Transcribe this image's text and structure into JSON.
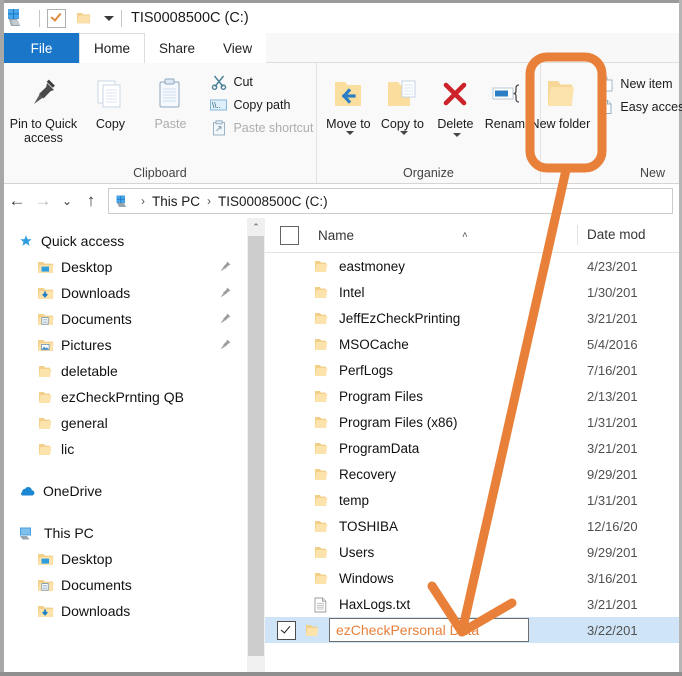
{
  "window": {
    "title": "TIS0008500C (C:)",
    "quick_access_icons": [
      "drive-icon",
      "properties-check-icon",
      "new-folder-icon",
      "customize-caret-icon"
    ]
  },
  "ribbon": {
    "tabs": [
      {
        "label": "File",
        "state": "file"
      },
      {
        "label": "Home",
        "state": "active"
      },
      {
        "label": "Share",
        "state": "normal"
      },
      {
        "label": "View",
        "state": "normal"
      }
    ],
    "groups": [
      {
        "name": "Clipboard",
        "label": "Clipboard",
        "big_buttons": [
          {
            "label": "Pin to Quick access",
            "icon": "pin-icon",
            "disabled": false
          },
          {
            "label": "Copy",
            "icon": "copy-icon",
            "disabled": false
          },
          {
            "label": "Paste",
            "icon": "paste-icon",
            "disabled": true
          }
        ],
        "small_buttons": [
          {
            "label": "Cut",
            "icon": "scissors-icon",
            "disabled": false
          },
          {
            "label": "Copy path",
            "icon": "copy-path-icon",
            "disabled": false
          },
          {
            "label": "Paste shortcut",
            "icon": "paste-shortcut-icon",
            "disabled": true
          }
        ]
      },
      {
        "name": "Organize",
        "label": "Organize",
        "big_buttons": [
          {
            "label": "Move to",
            "icon": "move-to-icon",
            "has_caret": true
          },
          {
            "label": "Copy to",
            "icon": "copy-to-icon",
            "has_caret": true
          },
          {
            "label": "Delete",
            "icon": "delete-x-icon",
            "has_caret": true
          },
          {
            "label": "Rename",
            "icon": "rename-icon",
            "has_caret": false
          }
        ]
      },
      {
        "name": "New",
        "label": "New",
        "big_buttons": [
          {
            "label": "New folder",
            "icon": "new-folder-icon",
            "highlighted": true
          }
        ],
        "small_buttons": [
          {
            "label": "New item",
            "icon": "new-item-icon",
            "has_caret": true
          },
          {
            "label": "Easy access",
            "icon": "easy-access-icon",
            "has_caret": true
          }
        ]
      }
    ]
  },
  "navigation": {
    "back_icon": "arrow-left-icon",
    "forward_icon": "arrow-right-icon",
    "recent_icon": "chevron-down-icon",
    "up_icon": "arrow-up-icon",
    "breadcrumb_icon": "this-pc-icon",
    "breadcrumbs": [
      "This PC",
      "TIS0008500C (C:)"
    ],
    "separator": "›"
  },
  "sidebar": {
    "sections": [
      {
        "header": {
          "label": "Quick access",
          "icon": "star-pin-icon"
        },
        "items": [
          {
            "label": "Desktop",
            "icon": "desktop-folder-icon",
            "pinned": true
          },
          {
            "label": "Downloads",
            "icon": "downloads-folder-icon",
            "pinned": true
          },
          {
            "label": "Documents",
            "icon": "documents-folder-icon",
            "pinned": true
          },
          {
            "label": "Pictures",
            "icon": "pictures-folder-icon",
            "pinned": true
          },
          {
            "label": "deletable",
            "icon": "folder-icon",
            "pinned": false
          },
          {
            "label": "ezCheckPrnting QB",
            "icon": "folder-icon",
            "pinned": false
          },
          {
            "label": "general",
            "icon": "folder-icon",
            "pinned": false
          },
          {
            "label": "lic",
            "icon": "folder-icon",
            "pinned": false
          }
        ]
      },
      {
        "header": {
          "label": "OneDrive",
          "icon": "onedrive-cloud-icon"
        },
        "items": []
      },
      {
        "header": {
          "label": "This PC",
          "icon": "this-pc-icon"
        },
        "items": [
          {
            "label": "Desktop",
            "icon": "desktop-folder-icon",
            "pinned": false
          },
          {
            "label": "Documents",
            "icon": "documents-folder-icon",
            "pinned": false
          },
          {
            "label": "Downloads",
            "icon": "downloads-folder-icon",
            "pinned": false
          }
        ]
      }
    ]
  },
  "filelist": {
    "columns": {
      "name": "Name",
      "date_modified": "Date mod"
    },
    "sort_indicator": "˄",
    "header_checkbox_checked": false,
    "rows": [
      {
        "name": "eastmoney",
        "icon": "folder-icon",
        "date": "4/23/201",
        "selected": false
      },
      {
        "name": "Intel",
        "icon": "folder-icon",
        "date": "1/30/201",
        "selected": false
      },
      {
        "name": "JeffEzCheckPrinting",
        "icon": "folder-icon",
        "date": "3/21/201",
        "selected": false
      },
      {
        "name": "MSOCache",
        "icon": "folder-icon",
        "date": "5/4/2016",
        "selected": false
      },
      {
        "name": "PerfLogs",
        "icon": "folder-icon",
        "date": "7/16/201",
        "selected": false
      },
      {
        "name": "Program Files",
        "icon": "folder-icon",
        "date": "2/13/201",
        "selected": false
      },
      {
        "name": "Program Files (x86)",
        "icon": "folder-icon",
        "date": "1/31/201",
        "selected": false
      },
      {
        "name": "ProgramData",
        "icon": "folder-icon",
        "date": "3/21/201",
        "selected": false
      },
      {
        "name": "Recovery",
        "icon": "folder-icon",
        "date": "9/29/201",
        "selected": false
      },
      {
        "name": "temp",
        "icon": "folder-icon",
        "date": "1/31/201",
        "selected": false
      },
      {
        "name": "TOSHIBA",
        "icon": "folder-icon",
        "date": "12/16/20",
        "selected": false
      },
      {
        "name": "Users",
        "icon": "folder-icon",
        "date": "9/29/201",
        "selected": false
      },
      {
        "name": "Windows",
        "icon": "folder-icon",
        "date": "3/16/201",
        "selected": false
      },
      {
        "name": "HaxLogs.txt",
        "icon": "text-file-icon",
        "date": "3/21/201",
        "selected": false
      }
    ],
    "editing_row": {
      "name": "ezCheckPersonal Data",
      "icon": "folder-icon",
      "date": "3/22/201",
      "checked": true,
      "editing": true
    }
  },
  "annotations": {
    "highlight_target": "New folder",
    "arrow_color": "#e8803a",
    "highlight_color": "#e8803a"
  },
  "colors": {
    "accent_blue": "#1976c8",
    "selection_blue": "#cfe5f7",
    "folder_yellow": "#fcd88b",
    "annotation_orange": "#e8803a"
  }
}
